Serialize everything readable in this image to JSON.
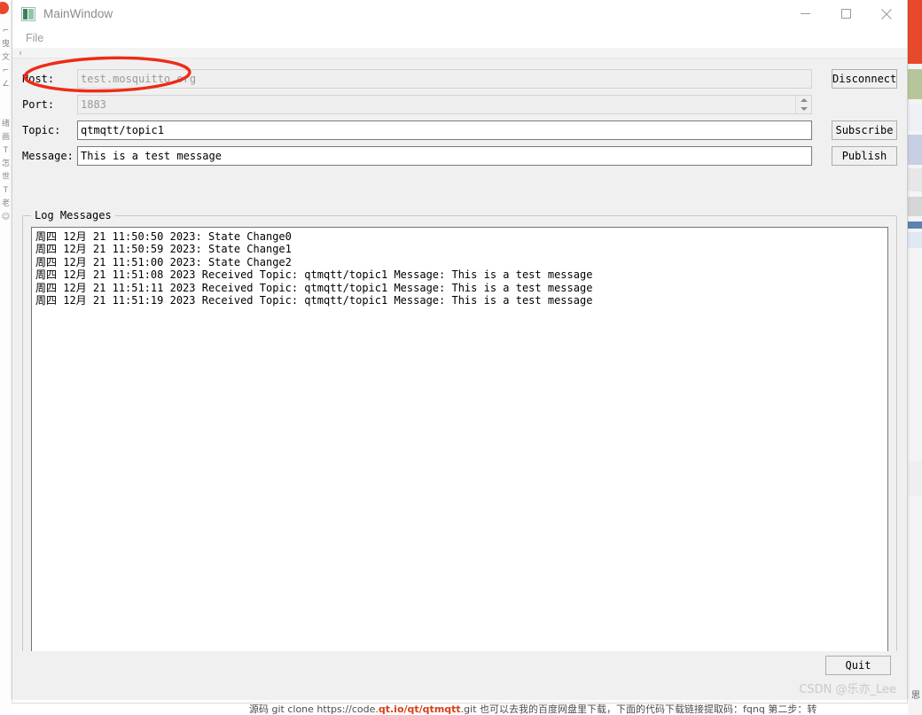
{
  "window": {
    "title": "MainWindow",
    "icon": "app-icon",
    "controls": {
      "minimize": "minimize-icon",
      "maximize": "maximize-icon",
      "close": "close-icon"
    }
  },
  "menubar": {
    "items": [
      {
        "label": "File"
      }
    ]
  },
  "form": {
    "host": {
      "label": "Host:",
      "value": "test.mosquitto.org",
      "enabled": false
    },
    "port": {
      "label": "Port:",
      "value": "1883",
      "enabled": false,
      "spinner": {
        "up": "spin-up-arrow",
        "down": "spin-down-arrow"
      }
    },
    "topic": {
      "label": "Topic:",
      "value": "qtmqtt/topic1",
      "enabled": true
    },
    "message": {
      "label": "Message:",
      "value": "This is a test message",
      "enabled": true
    }
  },
  "buttons": {
    "disconnect": "Disconnect",
    "subscribe": "Subscribe",
    "publish": "Publish",
    "quit": "Quit"
  },
  "log_group": {
    "title": "Log Messages",
    "lines": [
      "周四 12月 21 11:50:50 2023: State Change0",
      "周四 12月 21 11:50:59 2023: State Change1",
      "周四 12月 21 11:51:00 2023: State Change2",
      "周四 12月 21 11:51:08 2023 Received Topic: qtmqtt/topic1 Message: This is a test message",
      "周四 12月 21 11:51:11 2023 Received Topic: qtmqtt/topic1 Message: This is a test message",
      "周四 12月 21 11:51:19 2023 Received Topic: qtmqtt/topic1 Message: This is a test message"
    ]
  },
  "watermark": {
    "text": "CSDN @乐亦_Lee"
  },
  "annotation": {
    "shape": "red-ellipse",
    "color": "#ee2b17",
    "targets": "host-field"
  },
  "backdrop": {
    "left_strip_glyphs": "⌐\n曳\n文\n⌐\n∠\n\n\n绪\n画\nT\n怎\n世\nT\n老\n☺",
    "bottom_text_prefix": "源码 git clone https://code.",
    "bottom_text_link": "qt.io/qt/qtmqtt",
    "bottom_text_suffix": ".git 也可以去我的百度网盘里下载，下面的代码下载链接提取码：fqnq 第二步：转",
    "right_edge_colors": [
      "#e8492a",
      "#b6c69a",
      "#c3cde0",
      "#dadada",
      "#5b82b0"
    ]
  }
}
